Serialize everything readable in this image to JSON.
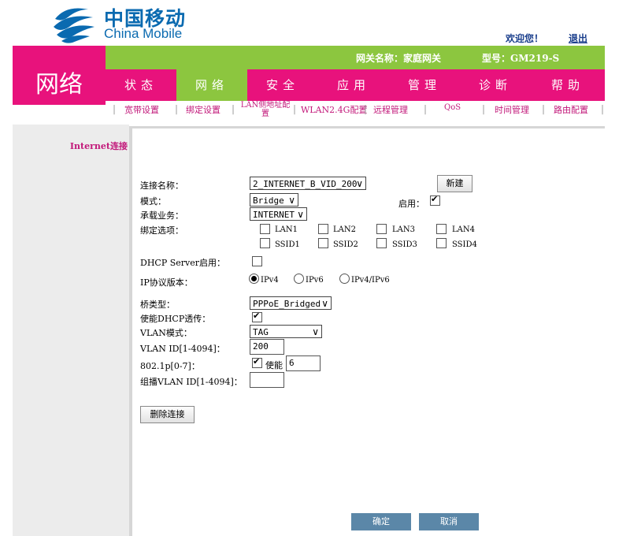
{
  "brand": {
    "name_cn": "中国移动",
    "name_en": "China Mobile"
  },
  "header": {
    "welcome": "欢迎您！",
    "logout": "退出",
    "gateway_name": "网关名称：家庭网关",
    "model": "型号：GM219-S"
  },
  "section_title": "网络",
  "nav": [
    "状态",
    "网络",
    "安全",
    "应用",
    "管理",
    "诊断",
    "帮助"
  ],
  "subnav": [
    "宽带设置",
    "绑定设置",
    "LAN侧地址配置",
    "WLAN2.4G配置",
    "远程管理",
    "QoS",
    "时间管理",
    "路由配置"
  ],
  "sidebar": {
    "item": "Internet连接"
  },
  "form": {
    "conn_name_label": "连接名称：",
    "conn_name_value": "2_INTERNET_B_VID_200",
    "new_button": "新建",
    "mode_label": "模式：",
    "mode_value": "Bridge",
    "enable_label": "启用：",
    "service_label": "承载业务：",
    "service_value": "INTERNET",
    "bind_label": "绑定选项：",
    "bind_options": [
      "LAN1",
      "LAN2",
      "LAN3",
      "LAN4",
      "SSID1",
      "SSID2",
      "SSID3",
      "SSID4"
    ],
    "dhcp_server_label": "DHCP Server启用：",
    "ip_version_label": "IP协议版本：",
    "ip_versions": [
      "IPv4",
      "IPv6",
      "IPv4/IPv6"
    ],
    "bridge_type_label": "桥类型：",
    "bridge_type_value": "PPPoE_Bridged",
    "dhcp_passthrough_label": "使能DHCP透传：",
    "vlan_mode_label": "VLAN模式：",
    "vlan_mode_value": "TAG",
    "vlan_id_label": "VLAN ID[1-4094]：",
    "vlan_id_value": "200",
    "p8021_label": "802.1p[0-7]：",
    "p8021_enable": "使能",
    "p8021_value": "6",
    "mcast_vlan_label": "组播VLAN ID[1-4094]：",
    "mcast_vlan_value": "",
    "delete_button": "删除连接"
  },
  "footer": {
    "ok": "确定",
    "cancel": "取消"
  }
}
